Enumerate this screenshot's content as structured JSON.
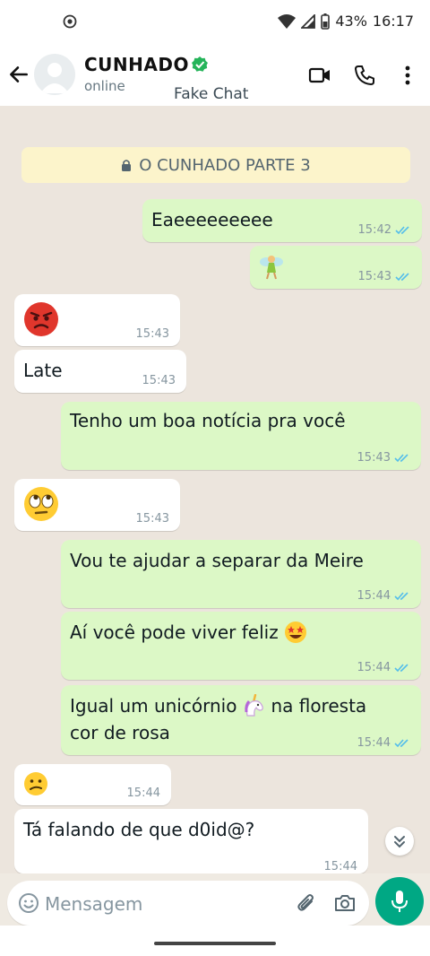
{
  "status": {
    "battery": "43%",
    "time": "16:17"
  },
  "header": {
    "name": "CUNHADO",
    "presence": "online",
    "watermark": "Fake Chat"
  },
  "chat": {
    "banner": "O CUNHADO PARTE 3",
    "messages": [
      {
        "text": "Eaeeeeeeeee",
        "time": "15:42"
      },
      {
        "text": "",
        "time": "15:43",
        "emoji": "fairy"
      },
      {
        "text": "",
        "time": "15:43",
        "emoji": "angry-face"
      },
      {
        "text": "Late",
        "time": "15:43"
      },
      {
        "text": "Tenho um boa notícia pra você",
        "time": "15:43"
      },
      {
        "text": "",
        "time": "15:43",
        "emoji": "eye-roll-face"
      },
      {
        "text": "Vou te ajudar a separar da Meire",
        "time": "15:44"
      },
      {
        "text": "Aí você pode viver feliz",
        "time": "15:44",
        "emoji": "star-struck-face"
      },
      {
        "line1": "Igual um unicórnio",
        "line1b": "na floresta",
        "line2": "cor de rosa",
        "time": "15:44",
        "emoji": "unicorn"
      },
      {
        "text": "",
        "time": "15:44",
        "emoji": "confused-face"
      },
      {
        "text": "Tá falando de que d0id@?",
        "time": "15:44"
      }
    ]
  },
  "composer": {
    "placeholder": "Mensagem"
  },
  "colors": {
    "accent": "#00a884",
    "outgoing": "#dcf8c6",
    "incoming": "#ffffff",
    "tick": "#53bdeb"
  }
}
